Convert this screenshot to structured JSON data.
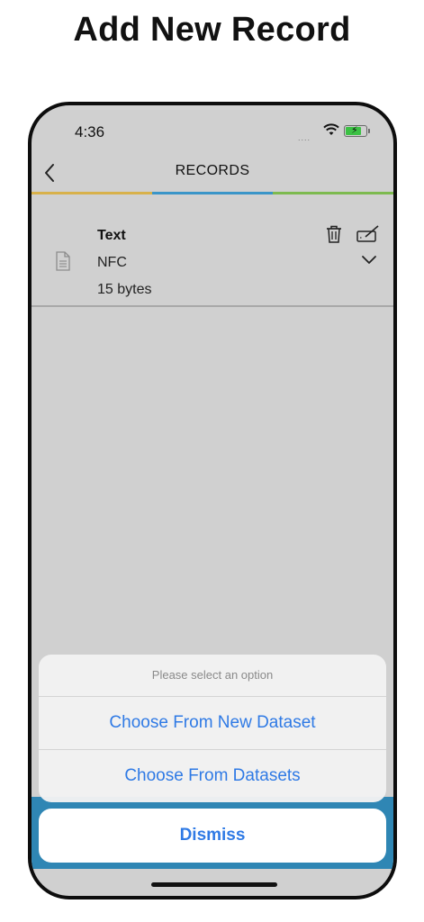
{
  "headline": "Add New Record",
  "status_bar": {
    "time": "4:36",
    "signal": "....",
    "battery_level": 0.8,
    "battery_color": "#3cc144"
  },
  "nav": {
    "title": "RECORDS",
    "back_icon": "chevron-left-icon"
  },
  "accent_colors": [
    "#d8b14a",
    "#3a95c8",
    "#7dba4f"
  ],
  "record": {
    "title": "Text",
    "type": "NFC",
    "size": "15 bytes"
  },
  "action_sheet": {
    "title": "Please select an option",
    "options": [
      "Choose From New Dataset",
      "Choose From Datasets"
    ],
    "dismiss_label": "Dismiss",
    "action_color": "#2f7ae5"
  },
  "tab_bar_color": "#2f86b4"
}
